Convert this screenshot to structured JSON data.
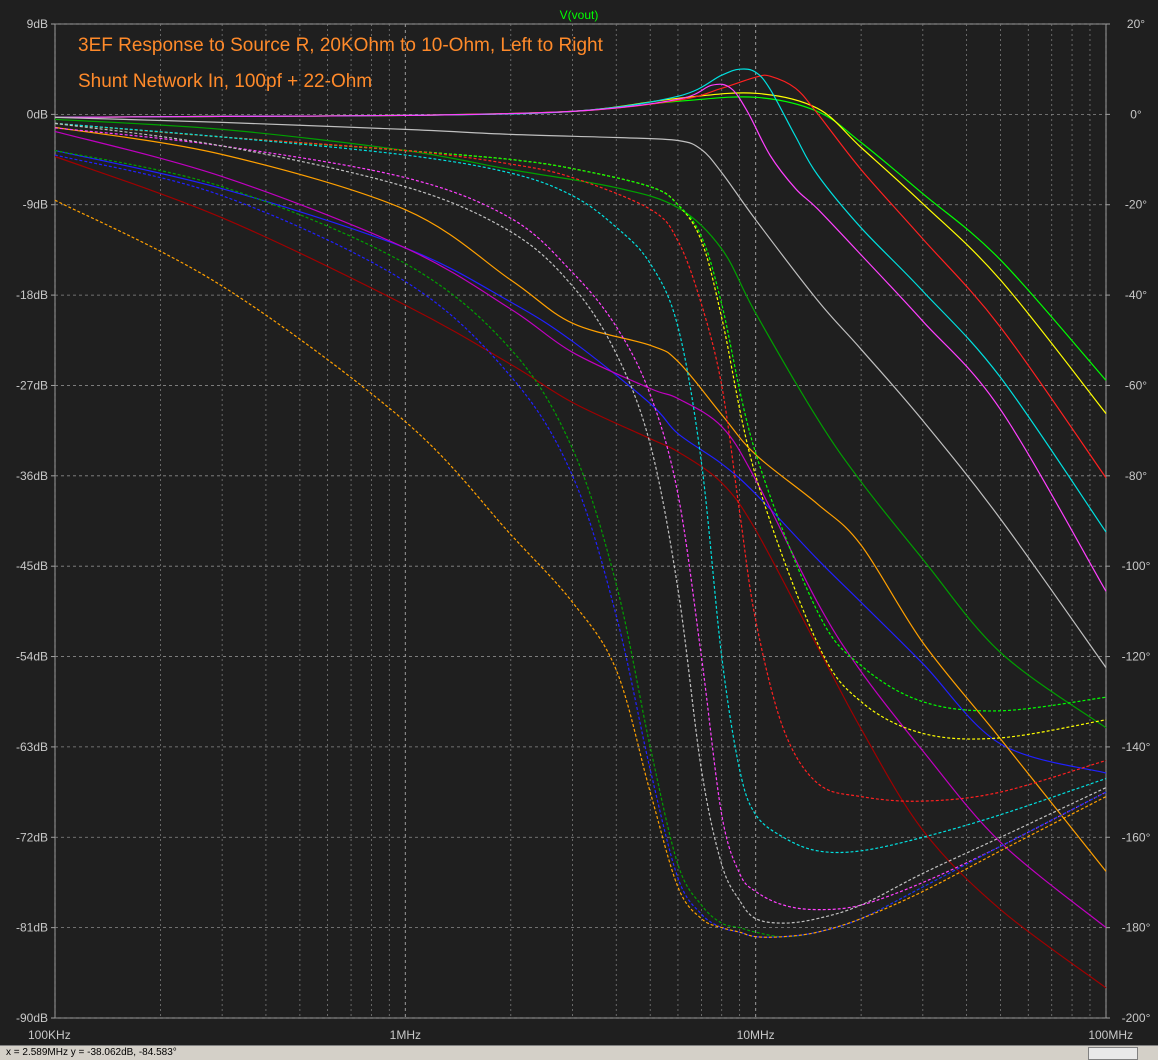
{
  "chart_data": {
    "type": "line",
    "title": "V(vout)",
    "annotations": [
      "3EF Response to Source R, 20KOhm to 10-Ohm, Left to Right",
      "Shunt Network In, 100pf + 22-Ohm"
    ],
    "x_scale": "log",
    "xlim": [
      100000,
      100000000
    ],
    "x_ticks": [
      {
        "value": 100000,
        "label": "100KHz"
      },
      {
        "value": 1000000,
        "label": "1MHz"
      },
      {
        "value": 10000000,
        "label": "10MHz"
      },
      {
        "value": 100000000,
        "label": "100MHz"
      }
    ],
    "ylim_left": [
      -90,
      9
    ],
    "y_ticks_left": [
      "9dB",
      "0dB",
      "-9dB",
      "-18dB",
      "-27dB",
      "-36dB",
      "-45dB",
      "-54dB",
      "-63dB",
      "-72dB",
      "-81dB",
      "-90dB"
    ],
    "y_tick_values_left": [
      9,
      0,
      -9,
      -18,
      -27,
      -36,
      -45,
      -54,
      -63,
      -72,
      -81,
      -90
    ],
    "ylim_right": [
      -200,
      20
    ],
    "y_ticks_right": [
      "20°",
      "0°",
      "-20°",
      "-40°",
      "-60°",
      "-80°",
      "-100°",
      "-120°",
      "-140°",
      "-160°",
      "-180°",
      "-200°"
    ],
    "y_tick_values_right": [
      20,
      0,
      -20,
      -40,
      -60,
      -80,
      -100,
      -120,
      -140,
      -160,
      -180,
      -200
    ],
    "grid": true,
    "series": [
      {
        "axis": "left",
        "style": "solid",
        "color": "#00ff00",
        "x": [
          0.1,
          0.3,
          1,
          3,
          6,
          10,
          15,
          20,
          30,
          50,
          100
        ],
        "y": [
          -0.3,
          -0.2,
          -0.1,
          0.3,
          1.3,
          1.7,
          0.3,
          -2.8,
          -7.9,
          -14.5,
          -26.5
        ]
      },
      {
        "axis": "left",
        "style": "solid",
        "color": "#ffff00",
        "x": [
          0.1,
          0.3,
          1,
          3,
          6,
          10,
          15,
          20,
          30,
          50,
          100
        ],
        "y": [
          -0.3,
          -0.2,
          -0.1,
          0.3,
          1.6,
          2.1,
          0.6,
          -3.3,
          -8.9,
          -16.5,
          -29.8
        ]
      },
      {
        "axis": "left",
        "style": "solid",
        "color": "#ff2020",
        "x": [
          0.1,
          0.3,
          1,
          3,
          6,
          8,
          10,
          11,
          13,
          15,
          20,
          30,
          50,
          100
        ],
        "y": [
          -0.3,
          -0.2,
          -0.1,
          0.3,
          1.4,
          2.6,
          3.7,
          3.8,
          2.6,
          0.1,
          -5.5,
          -12.4,
          -21.2,
          -36.2
        ]
      },
      {
        "axis": "left",
        "style": "solid",
        "color": "#00e0e0",
        "x": [
          0.1,
          0.3,
          1,
          3,
          6,
          8,
          9,
          10,
          11,
          13,
          15,
          20,
          30,
          50,
          100
        ],
        "y": [
          -0.3,
          -0.2,
          -0.1,
          0.3,
          1.8,
          3.9,
          4.5,
          4.2,
          2.5,
          -2.2,
          -6.0,
          -11.3,
          -17.6,
          -26.2,
          -41.6
        ]
      },
      {
        "axis": "left",
        "style": "solid",
        "color": "#ff40ff",
        "x": [
          0.1,
          0.3,
          1,
          3,
          6,
          7.5,
          8.5,
          9.5,
          11,
          13,
          15,
          20,
          30,
          50,
          100
        ],
        "y": [
          -0.3,
          -0.2,
          -0.1,
          0.3,
          1.5,
          2.9,
          2.6,
          0.2,
          -4.1,
          -7.4,
          -9.4,
          -14.0,
          -20.6,
          -29.4,
          -47.5
        ]
      },
      {
        "axis": "left",
        "style": "solid",
        "color": "#c0c0c0",
        "x": [
          0.1,
          0.3,
          1,
          2,
          4,
          6,
          7,
          8,
          10,
          15,
          20,
          30,
          50,
          100
        ],
        "y": [
          -0.3,
          -0.8,
          -1.5,
          -2.0,
          -2.3,
          -2.6,
          -3.5,
          -5.8,
          -10.5,
          -18.5,
          -23.4,
          -30.5,
          -40.3,
          -55.1
        ]
      },
      {
        "axis": "left",
        "style": "solid",
        "color": "#00a000",
        "x": [
          0.1,
          0.3,
          1,
          2,
          4,
          6,
          8,
          10,
          15,
          20,
          30,
          50,
          100
        ],
        "y": [
          -0.5,
          -1.5,
          -3.6,
          -5.5,
          -7.3,
          -9.3,
          -13.4,
          -19.8,
          -30.3,
          -36.6,
          -44.3,
          -53.6,
          -61.1
        ]
      },
      {
        "axis": "left",
        "style": "solid",
        "color": "#2020ff",
        "x": [
          0.1,
          0.3,
          1,
          2,
          3,
          5,
          6,
          8,
          10,
          15,
          20,
          30,
          50,
          100
        ],
        "y": [
          -3.6,
          -7.4,
          -13.3,
          -18.7,
          -22.6,
          -28.8,
          -31.8,
          -34.8,
          -37.8,
          -44.3,
          -48.6,
          -54.7,
          -62.7,
          -65.6
        ]
      },
      {
        "axis": "left",
        "style": "solid",
        "color": "#ffa000",
        "x": [
          0.1,
          0.3,
          1,
          2,
          3,
          5,
          6,
          8,
          10,
          15,
          20,
          30,
          50,
          100
        ],
        "y": [
          -1.3,
          -4.0,
          -9.5,
          -16.5,
          -20.8,
          -23.0,
          -24.6,
          -29.9,
          -33.9,
          -38.8,
          -42.9,
          -52.6,
          -62.2,
          -75.4
        ]
      },
      {
        "axis": "left",
        "style": "solid",
        "color": "#c000c0",
        "x": [
          0.1,
          0.3,
          1,
          2,
          3,
          5,
          6,
          8,
          10,
          15,
          20,
          30,
          50,
          100
        ],
        "y": [
          -1.7,
          -6.2,
          -13.3,
          -19.4,
          -23.7,
          -27.3,
          -28.3,
          -31.1,
          -36.4,
          -48.6,
          -55.5,
          -63.4,
          -72.5,
          -81.0
        ]
      },
      {
        "axis": "left",
        "style": "solid",
        "color": "#a00000",
        "x": [
          0.1,
          0.3,
          1,
          2,
          3,
          5,
          6,
          8,
          10,
          15,
          20,
          30,
          50,
          100
        ],
        "y": [
          -4.2,
          -10.3,
          -19.0,
          -24.9,
          -28.7,
          -32.3,
          -33.6,
          -36.7,
          -41.4,
          -53.0,
          -61.2,
          -71.3,
          -79.2,
          -87.0
        ]
      },
      {
        "axis": "right",
        "style": "dashed",
        "color": "#ffff00",
        "x": [
          0.1,
          0.3,
          1,
          2,
          3,
          5,
          6,
          7,
          8,
          10,
          15,
          20,
          30,
          50,
          100
        ],
        "y": [
          -2,
          -5,
          -8,
          -10,
          -12,
          -16,
          -20,
          -28,
          -45,
          -80,
          -117,
          -130,
          -137,
          -138,
          -134
        ]
      },
      {
        "axis": "right",
        "style": "dashed",
        "color": "#00ff00",
        "x": [
          0.1,
          0.3,
          1,
          2,
          3,
          5,
          6,
          7,
          8,
          10,
          15,
          20,
          30,
          50,
          100
        ],
        "y": [
          -2,
          -5,
          -8,
          -10,
          -12,
          -16,
          -20,
          -27,
          -42,
          -75,
          -110,
          -122,
          -130,
          -132,
          -129
        ]
      },
      {
        "axis": "right",
        "style": "dashed",
        "color": "#ff2020",
        "x": [
          0.1,
          0.3,
          1,
          2,
          3,
          5,
          6,
          7,
          8,
          9,
          10,
          12,
          15,
          20,
          30,
          50,
          100
        ],
        "y": [
          -2,
          -5,
          -8,
          -11,
          -14,
          -21,
          -28,
          -42,
          -60,
          -88,
          -112,
          -136,
          -148,
          -151,
          -152,
          -150,
          -143
        ]
      },
      {
        "axis": "right",
        "style": "dashed",
        "color": "#00e0e0",
        "x": [
          0.1,
          0.3,
          1,
          2,
          3,
          4,
          5,
          6,
          7,
          8,
          9,
          10,
          12,
          15,
          20,
          30,
          50,
          100
        ],
        "y": [
          -2,
          -5,
          -9,
          -13,
          -18,
          -25,
          -33,
          -47,
          -77,
          -120,
          -145,
          -155,
          -160,
          -163,
          -163,
          -160,
          -155,
          -147
        ]
      },
      {
        "axis": "right",
        "style": "dashed",
        "color": "#ff40ff",
        "x": [
          0.1,
          0.3,
          1,
          2,
          3,
          4,
          5,
          6,
          7,
          8,
          9,
          10,
          12,
          15,
          20,
          30,
          50,
          100
        ],
        "y": [
          -3,
          -7,
          -14,
          -23,
          -35,
          -47,
          -62,
          -84,
          -120,
          -155,
          -168,
          -172,
          -175,
          -176,
          -175,
          -170,
          -162,
          -150
        ]
      },
      {
        "axis": "right",
        "style": "dashed",
        "color": "#c0c0c0",
        "x": [
          0.1,
          0.3,
          1,
          2,
          3,
          4,
          5,
          6,
          7,
          8,
          9,
          10,
          12,
          15,
          20,
          30,
          50,
          100
        ],
        "y": [
          -2,
          -7,
          -16,
          -26,
          -38,
          -53,
          -73,
          -105,
          -145,
          -166,
          -174,
          -178,
          -179,
          -178,
          -175,
          -168,
          -160,
          -149
        ]
      },
      {
        "axis": "right",
        "style": "dashed",
        "color": "#00a000",
        "x": [
          0.1,
          0.3,
          1,
          2,
          3,
          4,
          5,
          6,
          7,
          8,
          9,
          10,
          12,
          15,
          20,
          30,
          50,
          100
        ],
        "y": [
          -8,
          -16,
          -33,
          -52,
          -74,
          -104,
          -140,
          -166,
          -175,
          -179,
          -180,
          -181,
          -182,
          -181,
          -178,
          -171,
          -162,
          -150
        ]
      },
      {
        "axis": "right",
        "style": "dashed",
        "color": "#2020ff",
        "x": [
          0.1,
          0.3,
          1,
          2,
          3,
          4,
          5,
          6,
          7,
          8,
          9,
          10,
          12,
          15,
          20,
          30,
          50,
          100
        ],
        "y": [
          -9,
          -18,
          -37,
          -58,
          -80,
          -111,
          -145,
          -169,
          -177,
          -180,
          -181,
          -182,
          -182,
          -181,
          -178,
          -171,
          -162,
          -150
        ]
      },
      {
        "axis": "right",
        "style": "dashed",
        "color": "#ffa000",
        "x": [
          0.1,
          0.3,
          1,
          2,
          3,
          4,
          5,
          6,
          7,
          8,
          9,
          10,
          12,
          15,
          20,
          30,
          50,
          100
        ],
        "y": [
          -19,
          -38,
          -68,
          -93,
          -108,
          -123,
          -150,
          -171,
          -178,
          -180,
          -181,
          -182,
          -182,
          -181,
          -178,
          -172,
          -163,
          -151
        ]
      }
    ]
  },
  "status": {
    "readout": "x = 2.589MHz    y = -38.062dB, -84.583°"
  }
}
